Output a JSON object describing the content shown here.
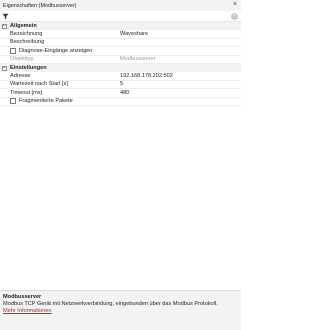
{
  "window": {
    "title": "Eigenschaften (Modbusserver)",
    "close_glyph": "×"
  },
  "toolbar": {
    "filter_icon": "filter-icon",
    "clear_icon": "clear-search-icon",
    "clear_glyph": "×"
  },
  "categories": {
    "allgemein": {
      "label": "Allgemein",
      "toggle": "−"
    },
    "einstellungen": {
      "label": "Einstellungen",
      "toggle": "−"
    }
  },
  "allgemein": {
    "bezeichnung": {
      "name": "Bezeichnung",
      "value": "Waveshare"
    },
    "beschreibung": {
      "name": "Beschreibung",
      "value": ""
    },
    "diagnose": {
      "name": "Diagnose-Eingänge anzeigen"
    },
    "objekttyp": {
      "name": "Objekttyp",
      "value": "Modbusserver"
    }
  },
  "einstellungen": {
    "adresse": {
      "name": "Adresse",
      "value": "192.168.178.202:502"
    },
    "wartezeit": {
      "name": "Wartezeit nach Start [s]",
      "value": "5"
    },
    "timeout": {
      "name": "Timeout [ms]",
      "value": "480"
    },
    "fragmentiert": {
      "name": "Fragmentierte Pakete"
    }
  },
  "description": {
    "title": "Modbusserver",
    "text": "Modbus TCP Gerät mit Netzwerkverbindung, eingebunden über das Modbus Protokoll.",
    "link": "Mehr Informationen"
  }
}
